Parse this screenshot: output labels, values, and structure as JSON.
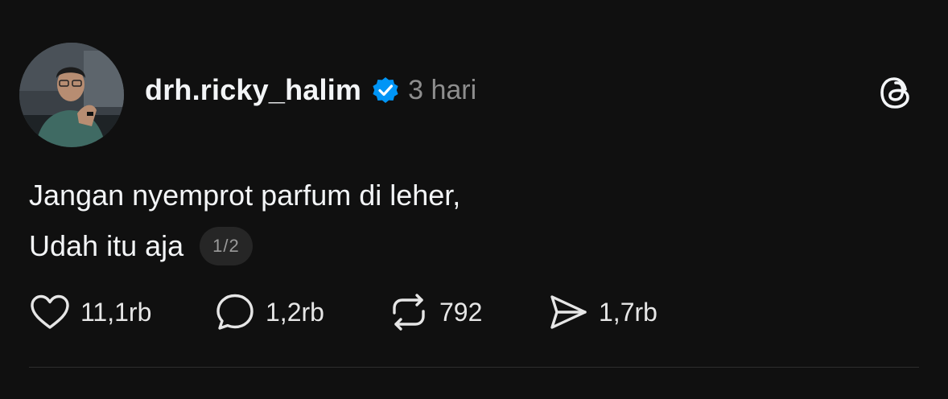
{
  "post": {
    "username": "drh.ricky_halim",
    "verified": true,
    "timestamp": "3 hari",
    "text_line1": "Jangan nyemprot parfum di leher,",
    "text_line2": "Udah itu aja",
    "page_indicator": "1/2"
  },
  "actions": {
    "likes": "11,1rb",
    "replies": "1,2rb",
    "reposts": "792",
    "shares": "1,7rb"
  },
  "icons": {
    "avatar": "avatar-photo",
    "verified": "verified-badge-icon",
    "brand": "threads-logo-icon",
    "like": "heart-icon",
    "reply": "comment-bubble-icon",
    "repost": "repost-icon",
    "share": "send-icon"
  },
  "colors": {
    "background": "#101010",
    "text": "#f3f5f7",
    "muted": "#8e8e8e",
    "verified": "#0095f6",
    "chip": "#262626"
  }
}
